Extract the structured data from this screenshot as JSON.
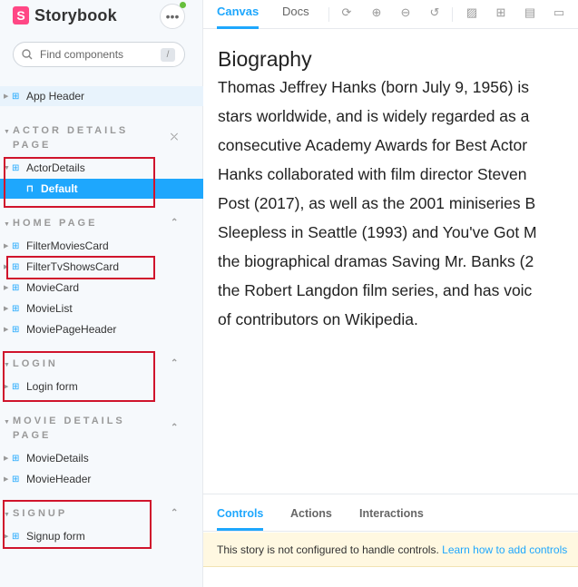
{
  "brand": {
    "logo_letter": "S",
    "name": "Storybook",
    "menu_label": "•••"
  },
  "search": {
    "placeholder": "Find components",
    "shortcut": "/"
  },
  "tree": {
    "top_items": [
      {
        "label": "App Header"
      }
    ],
    "groups": [
      {
        "title": "ACTOR DETAILS PAGE",
        "toggle": "⤫",
        "items": [
          {
            "label": "ActorDetails"
          },
          {
            "label": "Default",
            "selected": true
          }
        ]
      },
      {
        "title": "HOME PAGE",
        "toggle": "⌃",
        "items": [
          {
            "label": "FilterMoviesCard"
          },
          {
            "label": "FilterTvShowsCard"
          },
          {
            "label": "MovieCard"
          },
          {
            "label": "MovieList"
          },
          {
            "label": "MoviePageHeader"
          }
        ]
      },
      {
        "title": "LOGIN",
        "toggle": "⌃",
        "items": [
          {
            "label": "Login form"
          }
        ]
      },
      {
        "title": "MOVIE DETAILS PAGE",
        "toggle": "⌃",
        "items": [
          {
            "label": "MovieDetails"
          },
          {
            "label": "MovieHeader"
          }
        ]
      },
      {
        "title": "SIGNUP",
        "toggle": "⌃",
        "items": [
          {
            "label": "Signup form"
          }
        ]
      }
    ]
  },
  "toolbar": {
    "tabs": [
      {
        "label": "Canvas",
        "active": true
      },
      {
        "label": "Docs",
        "active": false
      }
    ],
    "tools": [
      "reload-icon",
      "zoom-in-icon",
      "zoom-out-icon",
      "zoom-reset-icon",
      "background-icon",
      "grid-icon",
      "viewport-icon",
      "measure-icon"
    ]
  },
  "canvas": {
    "title": "Biography",
    "lines": [
      "Thomas Jeffrey Hanks (born July 9, 1956) is",
      "stars worldwide, and is widely regarded as a",
      "consecutive Academy Awards for Best Actor",
      "Hanks collaborated with film director Steven",
      "Post (2017), as well as the 2001 miniseries B",
      "Sleepless in Seattle (1993) and You've Got M",
      "the biographical dramas Saving Mr. Banks (2",
      "the Robert Langdon film series, and has voic",
      "of contributors on Wikipedia."
    ]
  },
  "panel": {
    "tabs": [
      {
        "label": "Controls",
        "active": true
      },
      {
        "label": "Actions",
        "active": false
      },
      {
        "label": "Interactions",
        "active": false
      }
    ],
    "notice_text": "This story is not configured to handle controls. ",
    "notice_link": "Learn how to add controls"
  },
  "colors": {
    "accent": "#1ea7fd",
    "brand": "#ff4785",
    "highlight_box": "#d0142c",
    "notice_bg": "#fff8e1"
  }
}
